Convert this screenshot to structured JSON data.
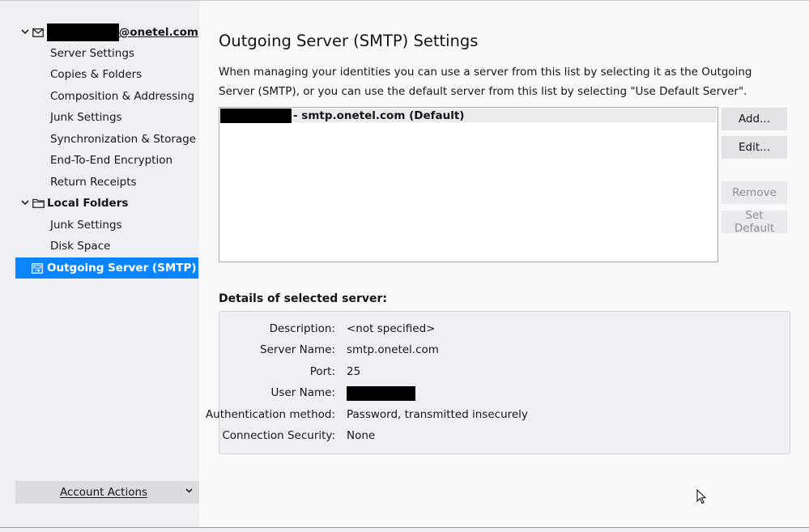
{
  "sidebar": {
    "account": {
      "email_suffix": "@onetel.com"
    },
    "account_items": [
      "Server Settings",
      "Copies & Folders",
      "Composition & Addressing",
      "Junk Settings",
      "Synchronization & Storage",
      "End-To-End Encryption",
      "Return Receipts"
    ],
    "local_folders": {
      "label": "Local Folders",
      "items": [
        "Junk Settings",
        "Disk Space"
      ]
    },
    "outgoing_server": "Outgoing Server (SMTP)",
    "account_actions": "Account Actions"
  },
  "main": {
    "title": "Outgoing Server (SMTP) Settings",
    "description": "When managing your identities you can use a server from this list by selecting it as the Outgoing Server (SMTP), or you can use the default server from this list by selecting \"Use Default Server\".",
    "server_list": [
      {
        "label": "- smtp.onetel.com (Default)"
      }
    ],
    "buttons": {
      "add": "Add...",
      "edit": "Edit...",
      "remove": "Remove",
      "set_default": "Set Default"
    },
    "details": {
      "title": "Details of selected server:",
      "description_label": "Description:",
      "description_value": "<not specified>",
      "server_name_label": "Server Name:",
      "server_name_value": "smtp.onetel.com",
      "port_label": "Port:",
      "port_value": "25",
      "user_name_label": "User Name:",
      "auth_label": "Authentication method:",
      "auth_value": "Password, transmitted insecurely",
      "security_label": "Connection Security:",
      "security_value": "None"
    }
  },
  "colors": {
    "accent": "#0a84ff",
    "redaction": "#000000"
  },
  "icons": [
    "chevron-down-icon",
    "envelope-icon",
    "folder-icon",
    "outgoing-server-icon",
    "mouse-cursor-icon"
  ]
}
